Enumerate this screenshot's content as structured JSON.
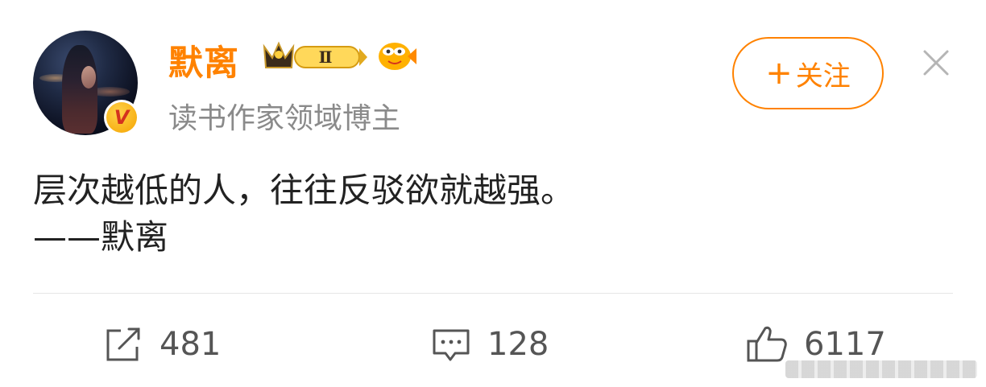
{
  "post": {
    "author": {
      "name": "默离",
      "verified_badge": "V",
      "subtitle": "读书作家领域博主",
      "level_badge": "Ⅱ"
    },
    "follow_label": "关注",
    "follow_plus": "+",
    "content_lines": [
      "层次越低的人，往往反驳欲就越强。",
      "——默离"
    ]
  },
  "actions": {
    "repost_count": "481",
    "comment_count": "128",
    "like_count": "6117"
  },
  "colors": {
    "accent": "#ff8200",
    "text": "#222222",
    "muted": "#8a8a8a"
  },
  "icons": {
    "repost": "share-icon",
    "comment": "comment-icon",
    "like": "thumbs-up-icon",
    "close": "close-icon"
  }
}
